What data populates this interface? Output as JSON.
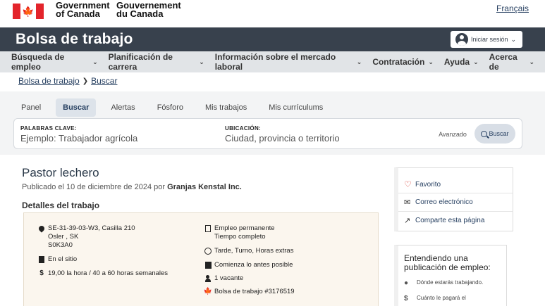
{
  "header": {
    "gov_en": [
      "Government",
      "of Canada"
    ],
    "gov_fr": [
      "Gouvernement",
      "du Canada"
    ],
    "language_link": "Français"
  },
  "site": {
    "title": "Bolsa de trabajo",
    "signin_label": "Iniciar sesión"
  },
  "nav": {
    "items": [
      {
        "label": "Búsqueda de empleo"
      },
      {
        "label": "Planificación de carrera"
      },
      {
        "label": "Información sobre el mercado laboral"
      },
      {
        "label": "Contratación"
      },
      {
        "label": "Ayuda"
      },
      {
        "label": "Acerca de"
      }
    ]
  },
  "breadcrumb": [
    "Bolsa de trabajo",
    "Buscar"
  ],
  "tabs": [
    {
      "label": "Panel",
      "active": false
    },
    {
      "label": "Buscar",
      "active": true
    },
    {
      "label": "Alertas",
      "active": false
    },
    {
      "label": "Fósforo",
      "active": false
    },
    {
      "label": "Mis trabajos",
      "active": false
    },
    {
      "label": "Mis currículums",
      "active": false
    }
  ],
  "search": {
    "keywords_label": "PALABRAS CLAVE:",
    "keywords_placeholder": "Ejemplo: Trabajador agrícola",
    "location_label": "UBICACIÓN:",
    "location_placeholder": "Ciudad, provincia o territorio",
    "advanced_label": "Avanzado",
    "search_label": "Buscar"
  },
  "job": {
    "title": "Pastor lechero",
    "posted_prefix": "Publicado el 10 de diciembre de 2024 por",
    "employer": "Granjas Kenstal Inc.",
    "details_heading": "Detalles del trabajo",
    "location_lines": [
      "SE-31-39-03-W3, Casilla 210",
      "Osler , SK",
      "S0K3A0"
    ],
    "workplace": "En el sitio",
    "salary": "19,00 la hora / 40 a 60 horas semanales",
    "employment_type": [
      "Empleo permanente",
      "Tiempo completo"
    ],
    "schedule": "Tarde, Turno, Horas extras",
    "start": "Comienza lo antes posible",
    "vacancies": "1 vacante",
    "job_bank_id": "Bolsa de trabajo #3176519"
  },
  "side_actions": {
    "favorite": "Favorito",
    "email": "Correo electrónico",
    "share": "Comparte esta página"
  },
  "info_panel": {
    "title": "Entendiendo una publicación de empleo:",
    "rows": [
      "Dónde estarás trabajando.",
      "Cuánto le pagará el"
    ]
  }
}
